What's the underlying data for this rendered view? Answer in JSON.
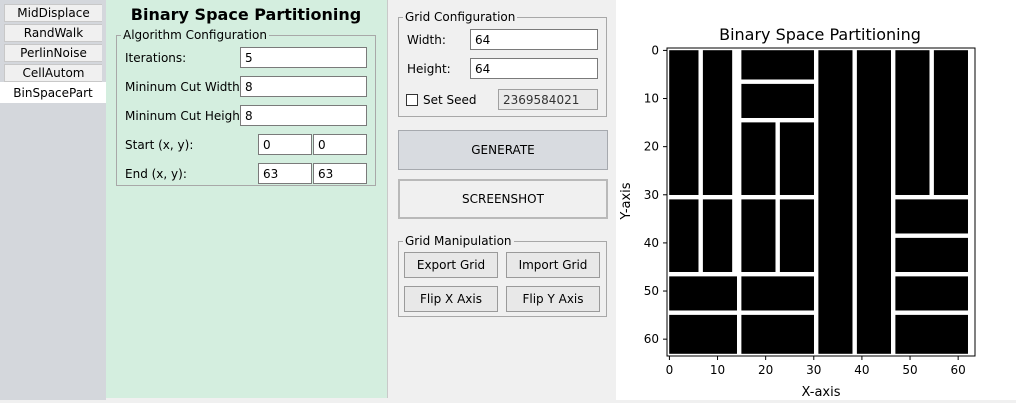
{
  "tabs": [
    "MidDisplace",
    "RandWalk",
    "PerlinNoise",
    "CellAutom",
    "BinSpacePart"
  ],
  "active_tab": 4,
  "panel": {
    "title": "Binary Space Partitioning",
    "algo": {
      "legend": "Algorithm Configuration",
      "iterations_label": "Iterations:",
      "iterations": "5",
      "min_cut_width_label": "Mininum Cut Width:",
      "min_cut_width": "8",
      "min_cut_height_label": "Mininum Cut Height:",
      "min_cut_height": "8",
      "start_label": "Start (x, y):",
      "start_x": "0",
      "start_y": "0",
      "end_label": "End (x, y):",
      "end_x": "63",
      "end_y": "63"
    }
  },
  "grid_config": {
    "legend": "Grid Configuration",
    "width_label": "Width:",
    "width": "64",
    "height_label": "Height:",
    "height": "64",
    "seed_label": "Set Seed",
    "seed": "2369584021",
    "seed_checked": false
  },
  "actions": {
    "generate": "GENERATE",
    "screenshot": "SCREENSHOT"
  },
  "manip": {
    "legend": "Grid Manipulation",
    "export": "Export Grid",
    "import": "Import Grid",
    "flip_x": "Flip X Axis",
    "flip_y": "Flip Y Axis"
  },
  "chart_data": {
    "type": "heatmap",
    "title": "Binary Space Partitioning",
    "xlabel": "X-axis",
    "ylabel": "Y-axis",
    "xlim": [
      0,
      64
    ],
    "ylim": [
      64,
      0
    ],
    "xticks": [
      0,
      10,
      20,
      30,
      40,
      50,
      60
    ],
    "yticks": [
      0,
      10,
      20,
      30,
      40,
      50,
      60
    ],
    "fill_color": "#000000",
    "gap_color": "#ffffff",
    "rooms": [
      [
        0,
        0,
        7,
        31
      ],
      [
        7,
        0,
        7,
        31
      ],
      [
        15,
        0,
        16,
        7
      ],
      [
        15,
        7,
        16,
        8
      ],
      [
        15,
        15,
        8,
        16
      ],
      [
        23,
        15,
        8,
        16
      ],
      [
        0,
        31,
        7,
        16
      ],
      [
        7,
        31,
        7,
        16
      ],
      [
        15,
        31,
        8,
        16
      ],
      [
        23,
        31,
        8,
        16
      ],
      [
        0,
        47,
        15,
        8
      ],
      [
        0,
        55,
        15,
        9
      ],
      [
        15,
        47,
        16,
        8
      ],
      [
        15,
        55,
        16,
        9
      ],
      [
        31,
        0,
        8,
        64
      ],
      [
        39,
        0,
        8,
        64
      ],
      [
        47,
        0,
        8,
        31
      ],
      [
        55,
        0,
        8,
        31
      ],
      [
        47,
        31,
        16,
        8
      ],
      [
        47,
        39,
        16,
        8
      ],
      [
        47,
        47,
        16,
        8
      ],
      [
        47,
        55,
        16,
        9
      ]
    ]
  }
}
